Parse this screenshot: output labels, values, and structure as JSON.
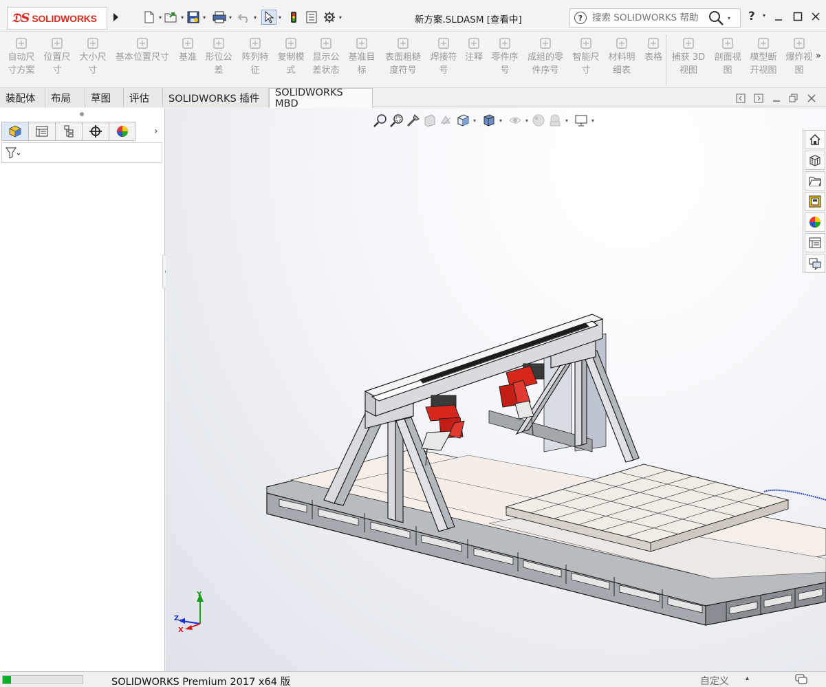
{
  "app": {
    "brand": "SOLIDWORKS",
    "document_title": "新方案.SLDASM [查看中]"
  },
  "search": {
    "placeholder": "搜索 SOLIDWORKS 帮助"
  },
  "help": {
    "label": "?"
  },
  "toolbar": {
    "commands": [
      {
        "label1": "自动尺",
        "label2": "寸方案",
        "icon": "auto-dimension-icon"
      },
      {
        "label1": "位置尺",
        "label2": "寸",
        "icon": "location-dimension-icon"
      },
      {
        "label1": "大小尺",
        "label2": "寸",
        "icon": "size-dimension-icon"
      },
      {
        "label1": "基本位置尺寸",
        "label2": "",
        "icon": "basic-location-dimension-icon"
      },
      {
        "label1": "基准",
        "label2": "",
        "icon": "datum-icon"
      },
      {
        "label1": "形位公",
        "label2": "差",
        "icon": "geometric-tolerance-icon"
      },
      {
        "label1": "阵列特",
        "label2": "征",
        "icon": "pattern-feature-icon"
      },
      {
        "label1": "复制模",
        "label2": "式",
        "icon": "copy-scheme-icon"
      },
      {
        "label1": "显示公",
        "label2": "差状态",
        "icon": "show-tolerance-status-icon"
      },
      {
        "label1": "基准目",
        "label2": "标",
        "icon": "datum-target-icon"
      },
      {
        "label1": "表面粗糙",
        "label2": "度符号",
        "icon": "surface-finish-icon"
      },
      {
        "label1": "焊接符",
        "label2": "号",
        "icon": "weld-symbol-icon"
      },
      {
        "label1": "注释",
        "label2": "",
        "icon": "note-icon"
      },
      {
        "label1": "零件序",
        "label2": "号",
        "icon": "balloon-icon"
      },
      {
        "label1": "成组的零",
        "label2": "件序号",
        "icon": "stacked-balloon-icon"
      },
      {
        "label1": "智能尺",
        "label2": "寸",
        "icon": "smart-dimension-icon"
      },
      {
        "label1": "材料明",
        "label2": "细表",
        "icon": "bom-icon"
      },
      {
        "label1": "表格",
        "label2": "",
        "icon": "table-icon"
      },
      {
        "label1": "捕获 3D",
        "label2": "视图",
        "icon": "capture-3d-view-icon"
      },
      {
        "label1": "剖面视",
        "label2": "图",
        "icon": "section-view-icon"
      },
      {
        "label1": "模型断",
        "label2": "开视图",
        "icon": "model-break-view-icon"
      },
      {
        "label1": "爆炸视",
        "label2": "图",
        "icon": "exploded-view-icon"
      }
    ],
    "more": "»"
  },
  "tabs": [
    {
      "label": "装配体"
    },
    {
      "label": "布局"
    },
    {
      "label": "草图"
    },
    {
      "label": "评估"
    },
    {
      "label": "SOLIDWORKS 插件"
    },
    {
      "label": "SOLIDWORKS MBD"
    }
  ],
  "triad": {
    "x": "X",
    "y": "Y",
    "z": "Z"
  },
  "status": {
    "product": "SOLIDWORKS Premium 2017 x64 版",
    "units": "自定义",
    "progress_fraction": 0.1
  },
  "colors": {
    "brand_red": "#d52b1e",
    "robot_red": "#d7261b",
    "frame_gray": "#8d9096",
    "progress_green": "#06b025"
  }
}
